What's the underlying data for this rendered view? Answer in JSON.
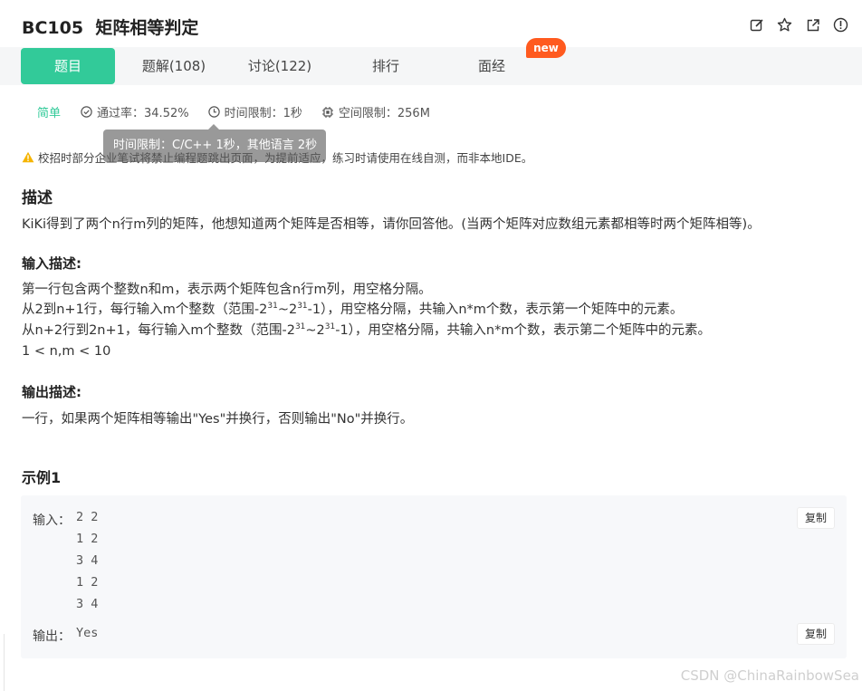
{
  "problem": {
    "id": "BC105",
    "name": "矩阵相等判定"
  },
  "header_icons": [
    "edit-icon",
    "star-icon",
    "external-link-icon",
    "report-icon"
  ],
  "tabs": [
    {
      "label": "题目",
      "active": true
    },
    {
      "label": "题解(108)",
      "active": false
    },
    {
      "label": "讨论(122)",
      "active": false
    },
    {
      "label": "排行",
      "active": false
    },
    {
      "label": "面经",
      "active": false
    }
  ],
  "new_badge": "new",
  "meta": {
    "difficulty": "简单",
    "pass_rate": "通过率：34.52%",
    "time_limit": "时间限制：1秒",
    "space_limit": "空间限制：256M"
  },
  "tooltip": "时间限制：C/C++ 1秒，其他语言 2秒",
  "warning": "校招时部分企业笔试将禁止编程题跳出页面，为提前适应，练习时请使用在线自测，而非本地IDE。",
  "description": {
    "heading": "描述",
    "text": "KiKi得到了两个n行m列的矩阵，他想知道两个矩阵是否相等，请你回答他。(当两个矩阵对应数组元素都相等时两个矩阵相等)。"
  },
  "input_desc": {
    "heading": "输入描述:",
    "line1": "第一行包含两个整数n和m，表示两个矩阵包含n行m列，用空格分隔。",
    "line2_a": "从2到n+1行，每行输入m个整数（范围-2",
    "line2_exp1": "31",
    "line2_b": "~2",
    "line2_exp2": "31",
    "line2_c": "-1），用空格分隔，共输入n*m个数，表示第一个矩阵中的元素。",
    "line3_a": "从n+2行到2n+1，每行输入m个整数（范围-2",
    "line3_exp1": "31",
    "line3_b": "~2",
    "line3_exp2": "31",
    "line3_c": "-1），用空格分隔，共输入n*m个数，表示第二个矩阵中的元素。",
    "line4": "1 < n,m < 10"
  },
  "output_desc": {
    "heading": "输出描述:",
    "text": "一行，如果两个矩阵相等输出\"Yes\"并换行，否则输出\"No\"并换行。"
  },
  "example": {
    "heading": "示例1",
    "input_label": "输入：",
    "input_value": "2 2\n1 2\n3 4\n1 2\n3 4",
    "output_label": "输出：",
    "output_value": "Yes",
    "copy_label": "复制"
  },
  "watermark": "CSDN @ChinaRainbowSea",
  "colors": {
    "accent": "#32ca99",
    "badge": "#ff5a1f",
    "warning": "#f5b400"
  }
}
